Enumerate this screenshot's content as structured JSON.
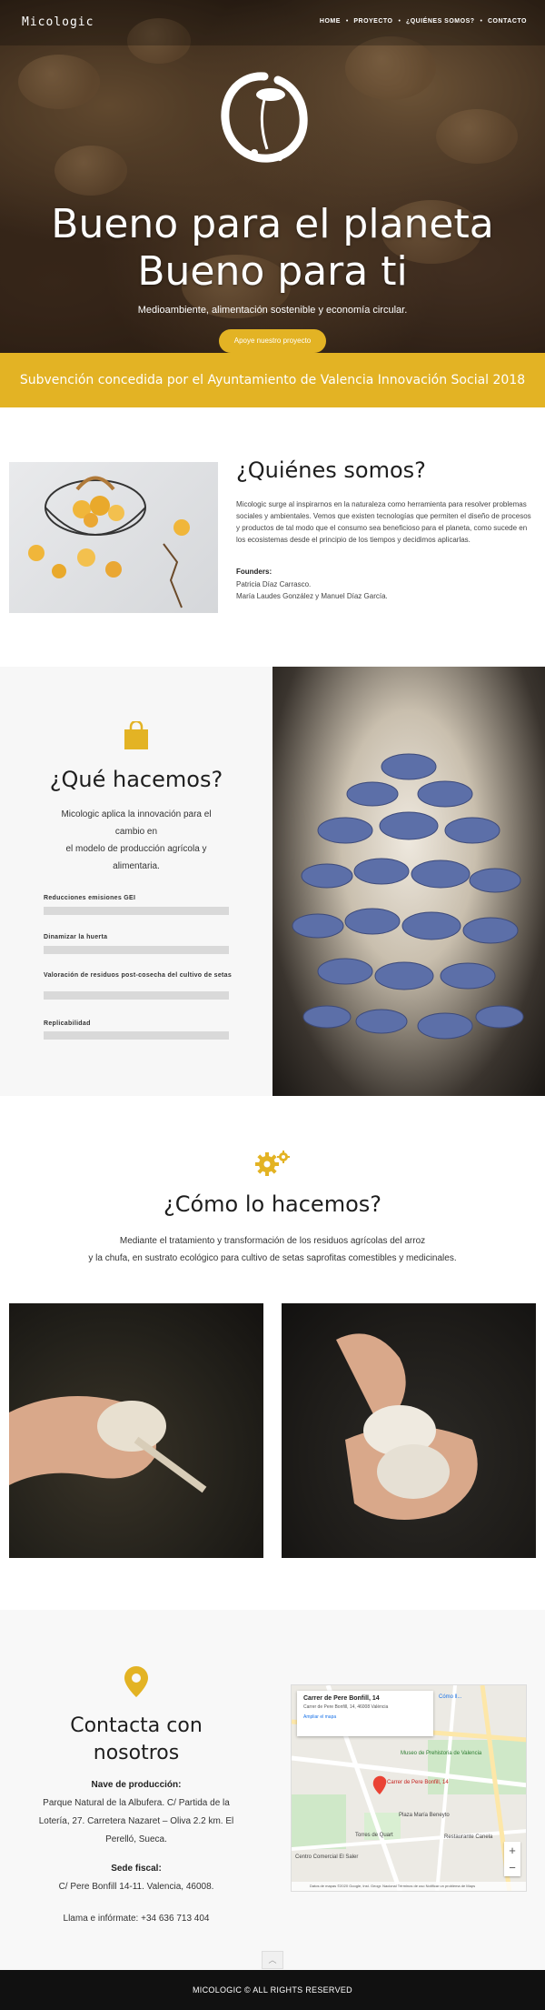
{
  "nav": {
    "logo": "Micologic",
    "items": [
      {
        "label": "HOME",
        "active": true
      },
      {
        "label": "PROYECTO"
      },
      {
        "label": "¿QUIÉNES SOMOS?"
      },
      {
        "label": "CONTACTO"
      }
    ]
  },
  "hero": {
    "title_line1": "Bueno para el planeta",
    "title_line2": "Bueno para ti",
    "subtitle": "Medioambiente, alimentación sostenible y economía circular.",
    "button_label": "Apoye nuestro proyecto"
  },
  "banner": {
    "text": "Subvención concedida por el Ayuntamiento de Valencia Innovación Social 2018"
  },
  "quienes": {
    "title": "¿Quiénes somos?",
    "text": "Micologic surge al inspirarnos en la naturaleza como herramienta para resolver problemas sociales y ambientales. Vemos que existen tecnologías que permiten el diseño de procesos y productos de tal modo que el consumo sea beneficioso para el planeta, como sucede en los ecosistemas desde el principio de los tiempos y decidimos aplicarlas.",
    "founders_label": "Founders:",
    "founder1": "Patricia Díaz Carrasco.",
    "founder2": "María Laudes González y Manuel Díaz García."
  },
  "que": {
    "title": "¿Qué hacemos?",
    "text_line1": "Micologic aplica la innovación para el cambio en",
    "text_line2": "el modelo de producción agrícola y alimentaria.",
    "bars": [
      {
        "label": "Reducciones emisiones GEI",
        "value": 1.0
      },
      {
        "label": "Dinamizar la huerta",
        "value": 1.0
      },
      {
        "label": "Valoración de residuos post-cosecha del cultivo de setas",
        "value": 1.0
      },
      {
        "label": "Replicabilidad",
        "value": 1.0
      }
    ]
  },
  "como": {
    "title": "¿Cómo lo hacemos?",
    "text_line1": "Mediante el tratamiento y transformación de los residuos agrícolas del arroz",
    "text_line2": "y la chufa, en sustrato ecológico para cultivo de setas saprofitas comestibles y medicinales."
  },
  "contacto": {
    "title": "Contacta con nosotros",
    "production_label": "Nave de producción:",
    "production_text": "Parque Natural de la Albufera. C/ Partida de la Lotería, 27. Carretera Nazaret – Oliva 2.2 km. El Perelló, Sueca.",
    "fiscal_label": "Sede fiscal:",
    "fiscal_text": "C/ Pere Bonfill 14-11. Valencia, 46008.",
    "phone_text": "Llama e infórmate: +34 636 713 404"
  },
  "map": {
    "card_title": "Carrer de Pere Bonfill, 14",
    "card_address": "Carrer de Pere Bonfill, 14, 46008 València",
    "card_link": "Ampliar el mapa",
    "directions": "Cómo ll...",
    "marker_label": "Carrer de Pere Bonfill, 14",
    "labels": [
      "Museo de Prehistoria de Valencia",
      "Plaza María Beneyto",
      "Torres de Quart",
      "Restaurante Canela",
      "Centro Comercial El Saler"
    ],
    "footer": "Datos de mapas ©2020 Google, Inst. Geogr. Nacional   Términos de uso   Notificar un problema de Maps"
  },
  "footer": {
    "text": "MICOLOGIC © ALL RIGHTS RESERVED"
  },
  "colors": {
    "accent": "#e3b324",
    "footer_bg": "#111111"
  },
  "icons": [
    "logo-emblem",
    "shopping-bag-icon",
    "gears-icon",
    "map-pin-icon",
    "chevron-up-icon"
  ]
}
